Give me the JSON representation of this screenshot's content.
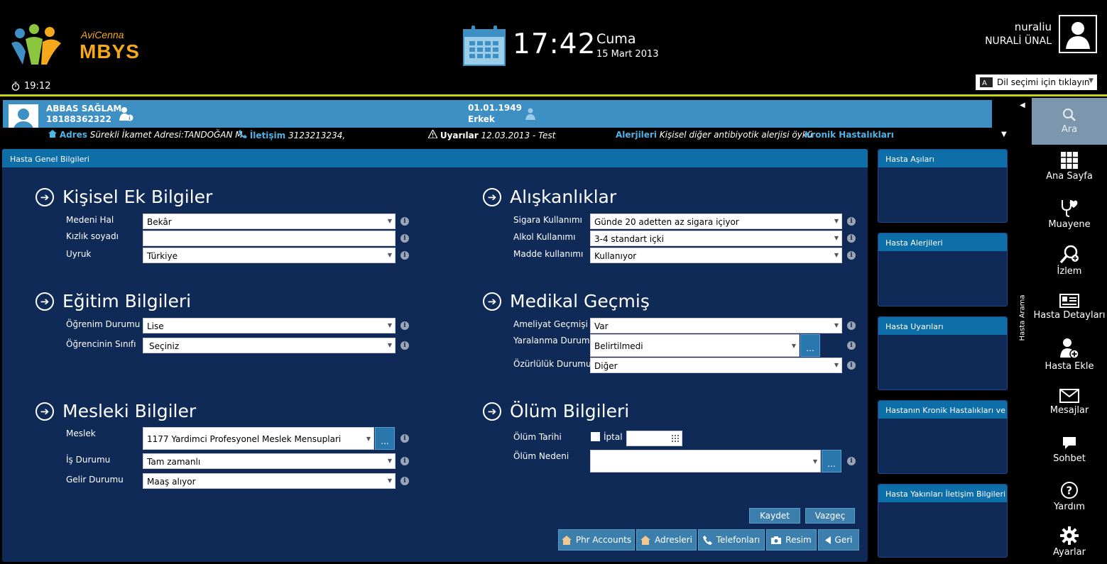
{
  "brand": {
    "sub": "AviCenna",
    "main": "MBYS",
    "colors": {
      "orange": "#f6a81c",
      "blue": "#3d8fc4",
      "green": "#8cc63f"
    }
  },
  "session_timer": "19:12",
  "clock": {
    "time": "17:42",
    "day": "Cuma",
    "date": "15 Mart 2013"
  },
  "user": {
    "username": "nuraliu",
    "fullname": "NURALİ ÜNAL"
  },
  "language_select": {
    "label": "Dil seçimi için tıklayın"
  },
  "patient": {
    "name": "ABBAS SAĞLAM",
    "id": "18188362322",
    "dob": "01.01.1949",
    "sex": "Erkek",
    "adres_label": "Adres",
    "adres_value": "Sürekli İkamet Adresi:TANDOĞAN M",
    "iletisim_label": "İletişim",
    "iletisim_value": "3123213234,",
    "uyarilar_label": "Uyarılar",
    "uyarilar_value": "12.03.2013 - Test",
    "alerjiler_label": "Alerjileri",
    "alerjiler_value": "Kişisel diğer antibiyotik alerjisi öykü",
    "kronik_label": "Kronik Hastalıkları"
  },
  "panel_title": "Hasta Genel Bilgileri",
  "sections": {
    "kisisel": {
      "title": "Kişisel Ek Bilgiler",
      "medeni_hal": {
        "label": "Medeni Hal",
        "value": "Bekâr"
      },
      "kizlik_soyadi": {
        "label": "Kızlık soyadı",
        "value": ""
      },
      "uyruk": {
        "label": "Uyruk",
        "value": "Türkiye"
      }
    },
    "egitim": {
      "title": "Eğitim Bilgileri",
      "ogrenim": {
        "label": "Öğrenim Durumu",
        "value": "Lise"
      },
      "sinif": {
        "label": "Öğrencinin Sınıfı",
        "value": "Seçiniz"
      }
    },
    "mesleki": {
      "title": "Mesleki Bilgiler",
      "meslek": {
        "label": "Meslek",
        "value": "1177 Yardimci Profesyonel Meslek Mensuplari"
      },
      "is_durumu": {
        "label": "İş Durumu",
        "value": "Tam zamanlı"
      },
      "gelir": {
        "label": "Gelir Durumu",
        "value": "Maaş alıyor"
      }
    },
    "aliskanliklar": {
      "title": "Alışkanlıklar",
      "sigara": {
        "label": "Sigara Kullanımı",
        "value": "Günde 20 adetten az sigara içiyor"
      },
      "alkol": {
        "label": "Alkol Kullanımı",
        "value": "3-4 standart içki"
      },
      "madde": {
        "label": "Madde kullanımı",
        "value": "Kullanıyor"
      }
    },
    "medikal": {
      "title": "Medikal Geçmiş",
      "ameliyat": {
        "label": "Ameliyat Geçmişi",
        "value": "Var"
      },
      "yaralanma": {
        "label": "Yaralanma Durumu",
        "value": "Belirtilmedi"
      },
      "ozurluluk": {
        "label": "Özürlülük Durumu",
        "value": "Diğer"
      }
    },
    "olum": {
      "title": "Ölüm Bilgileri",
      "tarih_label": "Ölüm Tarihi",
      "iptal_label": "İptal",
      "neden_label": "Ölüm Nedeni",
      "neden_value": ""
    }
  },
  "more_label": "...",
  "info_glyph": "i",
  "buttons": {
    "kaydet": "Kaydet",
    "vazgec": "Vazgeç",
    "phr": "Phr Accounts",
    "adresleri": "Adresleri",
    "telefonlari": "Telefonları",
    "resim": "Resim",
    "geri": "Geri"
  },
  "side_cards": [
    "Hasta Aşıları",
    "Hasta Alerjileri",
    "Hasta Uyarıları",
    "Hastanın Kronik Hastalıkları ve İlaç",
    "Hasta Yakınları İletişim Bilgileri"
  ],
  "sidebar": {
    "vertical_label": "Hasta Arama",
    "items": [
      "Ara",
      "Ana Sayfa",
      "Muayene",
      "İzlem",
      "Hasta Detayları",
      "Hasta Ekle",
      "Mesajlar",
      "Sohbet",
      "Yardım",
      "Ayarlar"
    ]
  }
}
